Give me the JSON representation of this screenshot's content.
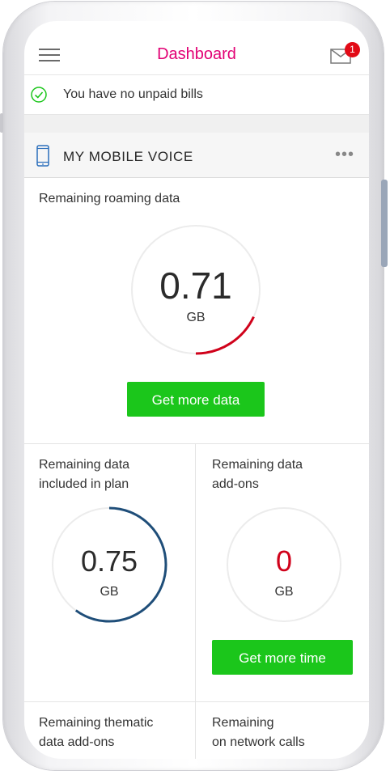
{
  "header": {
    "title": "Dashboard",
    "badge_count": "1"
  },
  "bills": {
    "message": "You have no unpaid bills"
  },
  "card": {
    "title": "MY MOBILE VOICE",
    "more": "•••"
  },
  "roaming": {
    "label": "Remaining roaming data",
    "value": "0.71",
    "unit": "GB",
    "fill_fraction": 0.18,
    "button": "Get more data"
  },
  "plan_data": {
    "label_line1": "Remaining data",
    "label_line2": "included in plan",
    "value": "0.75",
    "unit": "GB",
    "fill_fraction": 0.6
  },
  "addons": {
    "label_line1": "Remaining data",
    "label_line2": "add-ons",
    "value": "0",
    "unit": "GB",
    "fill_fraction": 0,
    "button": "Get more time"
  },
  "thematic": {
    "label_line1": "Remaining thematic",
    "label_line2": "data add-ons"
  },
  "network_calls": {
    "label_line1": "Remaining",
    "label_line2": "on network calls"
  },
  "colors": {
    "brand": "#e20074",
    "roaming_arc": "#d0021b",
    "plan_arc": "#1f4e79",
    "addon_value": "#d0021b",
    "button": "#1bc61b",
    "ring_track": "#ececec"
  },
  "icons": {
    "menu": "hamburger-icon",
    "mail": "envelope-icon",
    "check": "check-circle-icon",
    "phone": "smartphone-icon",
    "more": "more-dots-icon"
  }
}
